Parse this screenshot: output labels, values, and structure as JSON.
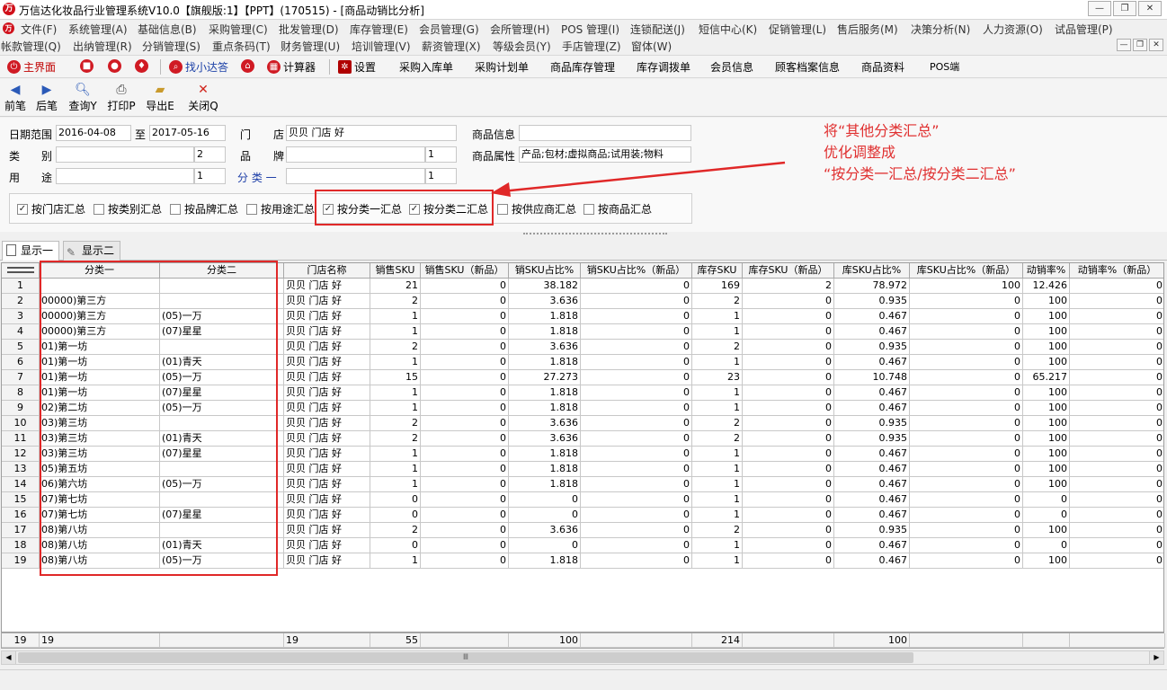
{
  "window": {
    "title": "万信达化妆品行业管理系统V10.0【旗舰版:1】【PPT】(170515) - [商品动销比分析]",
    "minimize": "—",
    "restore": "❐",
    "close": "✕"
  },
  "menu1": [
    "文件(F)",
    "系统管理(A)",
    "基础信息(B)",
    "采购管理(C)",
    "批发管理(D)",
    "库存管理(E)",
    "会员管理(G)",
    "会所管理(H)",
    "POS 管理(I)",
    "连锁配送(J)",
    "短信中心(K)",
    "促销管理(L)",
    "售后服务(M)",
    "决策分析(N)",
    "人力资源(O)",
    "试品管理(P)"
  ],
  "menu2": [
    "帐款管理(Q)",
    "出纳管理(R)",
    "分销管理(S)",
    "重点条码(T)",
    "财务管理(U)",
    "培训管理(V)",
    "薪资管理(X)",
    "等级会员(Y)",
    "手店管理(Z)",
    "窗体(W)"
  ],
  "toolbar1": {
    "main": "主界面",
    "find": "找小达答",
    "calc": "计算器",
    "settings": "设置",
    "links": [
      "采购入库单",
      "采购计划单",
      "商品库存管理",
      "库存调拨单",
      "会员信息",
      "顾客档案信息",
      "商品资料",
      "POS端"
    ]
  },
  "toolbar2": [
    "前笔",
    "后笔",
    "查询Y",
    "打印P",
    "导出E",
    "关闭Q"
  ],
  "filter": {
    "date_label": "日期范围",
    "date_from": "2016-04-08",
    "to_label": "至",
    "date_to": "2017-05-16",
    "store_label1": "门",
    "store_label2": "店",
    "store_value": "贝贝 门店 好",
    "product_info_label": "商品信息",
    "product_info_value": "",
    "category_label1": "类",
    "category_label2": "别",
    "category_value": "",
    "category_num": "2",
    "brand_label1": "品",
    "brand_label2": "牌",
    "brand_value": "",
    "brand_num": "1",
    "attr_label": "商品属性",
    "attr_value": "产品;包材;虚拟商品;试用装;物料",
    "usage_label1": "用",
    "usage_label2": "途",
    "usage_value": "",
    "usage_num": "1",
    "class1_label": "分 类 一",
    "class1_value": "",
    "class1_num": "1"
  },
  "checkboxes": [
    {
      "label": "按门店汇总",
      "checked": "✓"
    },
    {
      "label": "按类别汇总",
      "checked": ""
    },
    {
      "label": "按品牌汇总",
      "checked": ""
    },
    {
      "label": "按用途汇总",
      "checked": ""
    },
    {
      "label": "按分类一汇总",
      "checked": "✓"
    },
    {
      "label": "按分类二汇总",
      "checked": "✓"
    },
    {
      "label": "按供应商汇总",
      "checked": ""
    },
    {
      "label": "按商品汇总",
      "checked": ""
    }
  ],
  "annotation": {
    "line1": "将“其他分类汇总”",
    "line2": "优化调整成",
    "line3": "“按分类一汇总/按分类二汇总”"
  },
  "tabs": [
    "显示一",
    "显示二"
  ],
  "columns": [
    "分类一",
    "分类二",
    "门店名称",
    "销售SKU",
    "销售SKU（新品）",
    "销SKU占比%",
    "销SKU占比%（新品）",
    "库存SKU",
    "库存SKU（新品）",
    "库SKU占比%",
    "库SKU占比%（新品）",
    "动销率%",
    "动销率%（新品）"
  ],
  "rows": [
    [
      "1",
      "",
      "",
      "贝贝 门店 好",
      "21",
      "0",
      "38.182",
      "0",
      "169",
      "2",
      "78.972",
      "100",
      "12.426",
      "0"
    ],
    [
      "2",
      "00000)第三方",
      "",
      "贝贝 门店 好",
      "2",
      "0",
      "3.636",
      "0",
      "2",
      "0",
      "0.935",
      "0",
      "100",
      "0"
    ],
    [
      "3",
      "00000)第三方",
      "(05)一万",
      "贝贝 门店 好",
      "1",
      "0",
      "1.818",
      "0",
      "1",
      "0",
      "0.467",
      "0",
      "100",
      "0"
    ],
    [
      "4",
      "00000)第三方",
      "(07)星星",
      "贝贝 门店 好",
      "1",
      "0",
      "1.818",
      "0",
      "1",
      "0",
      "0.467",
      "0",
      "100",
      "0"
    ],
    [
      "5",
      "01)第一坊",
      "",
      "贝贝 门店 好",
      "2",
      "0",
      "3.636",
      "0",
      "2",
      "0",
      "0.935",
      "0",
      "100",
      "0"
    ],
    [
      "6",
      "01)第一坊",
      "(01)青天",
      "贝贝 门店 好",
      "1",
      "0",
      "1.818",
      "0",
      "1",
      "0",
      "0.467",
      "0",
      "100",
      "0"
    ],
    [
      "7",
      "01)第一坊",
      "(05)一万",
      "贝贝 门店 好",
      "15",
      "0",
      "27.273",
      "0",
      "23",
      "0",
      "10.748",
      "0",
      "65.217",
      "0"
    ],
    [
      "8",
      "01)第一坊",
      "(07)星星",
      "贝贝 门店 好",
      "1",
      "0",
      "1.818",
      "0",
      "1",
      "0",
      "0.467",
      "0",
      "100",
      "0"
    ],
    [
      "9",
      "02)第二坊",
      "(05)一万",
      "贝贝 门店 好",
      "1",
      "0",
      "1.818",
      "0",
      "1",
      "0",
      "0.467",
      "0",
      "100",
      "0"
    ],
    [
      "10",
      "03)第三坊",
      "",
      "贝贝 门店 好",
      "2",
      "0",
      "3.636",
      "0",
      "2",
      "0",
      "0.935",
      "0",
      "100",
      "0"
    ],
    [
      "11",
      "03)第三坊",
      "(01)青天",
      "贝贝 门店 好",
      "2",
      "0",
      "3.636",
      "0",
      "2",
      "0",
      "0.935",
      "0",
      "100",
      "0"
    ],
    [
      "12",
      "03)第三坊",
      "(07)星星",
      "贝贝 门店 好",
      "1",
      "0",
      "1.818",
      "0",
      "1",
      "0",
      "0.467",
      "0",
      "100",
      "0"
    ],
    [
      "13",
      "05)第五坊",
      "",
      "贝贝 门店 好",
      "1",
      "0",
      "1.818",
      "0",
      "1",
      "0",
      "0.467",
      "0",
      "100",
      "0"
    ],
    [
      "14",
      "06)第六坊",
      "(05)一万",
      "贝贝 门店 好",
      "1",
      "0",
      "1.818",
      "0",
      "1",
      "0",
      "0.467",
      "0",
      "100",
      "0"
    ],
    [
      "15",
      "07)第七坊",
      "",
      "贝贝 门店 好",
      "0",
      "0",
      "0",
      "0",
      "1",
      "0",
      "0.467",
      "0",
      "0",
      "0"
    ],
    [
      "16",
      "07)第七坊",
      "(07)星星",
      "贝贝 门店 好",
      "0",
      "0",
      "0",
      "0",
      "1",
      "0",
      "0.467",
      "0",
      "0",
      "0"
    ],
    [
      "17",
      "08)第八坊",
      "",
      "贝贝 门店 好",
      "2",
      "0",
      "3.636",
      "0",
      "2",
      "0",
      "0.935",
      "0",
      "100",
      "0"
    ],
    [
      "18",
      "08)第八坊",
      "(01)青天",
      "贝贝 门店 好",
      "0",
      "0",
      "0",
      "0",
      "1",
      "0",
      "0.467",
      "0",
      "0",
      "0"
    ],
    [
      "19",
      "08)第八坊",
      "(05)一万",
      "贝贝 门店 好",
      "1",
      "0",
      "1.818",
      "0",
      "1",
      "0",
      "0.467",
      "0",
      "100",
      "0"
    ]
  ],
  "footer": [
    "19",
    "19",
    "",
    "19",
    "55",
    "",
    "100",
    "",
    "214",
    "",
    "100",
    "",
    "",
    ""
  ],
  "scroll_grip": "Ⅲ"
}
